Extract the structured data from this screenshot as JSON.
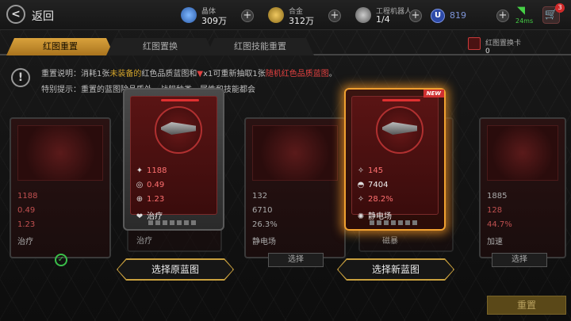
{
  "header": {
    "back_label": "返回",
    "resources": [
      {
        "name": "crystal",
        "label": "晶体",
        "value": "309万",
        "color": "#4a8fe0"
      },
      {
        "name": "alloy",
        "label": "合金",
        "value": "312万",
        "color": "#d4a52c"
      },
      {
        "name": "robot",
        "label": "工程机器人",
        "value": "1/4",
        "color": "#9a9a9a"
      }
    ],
    "u_value": "819",
    "ping": "24ms",
    "cart_badge": "3"
  },
  "tabs": [
    {
      "label": "红图重置",
      "active": true
    },
    {
      "label": "红图置换",
      "active": false
    },
    {
      "label": "红图技能重置",
      "active": false
    }
  ],
  "card_counter": {
    "label": "红图置换卡",
    "value": "0"
  },
  "notes": {
    "line1_a": "重置说明：消耗1张",
    "line1_b": "未装备的",
    "line1_c": "红色品质蓝图和",
    "line1_d": "x1可重新抽取1张",
    "line1_e": "随机红色品质蓝图",
    "line1_f": "。",
    "line2": "特别提示：重置的蓝图除品质外，战舰种类、属性和技能都会"
  },
  "cards": [
    {
      "stats": [
        "1188",
        "0.49",
        "1.23",
        "治疗"
      ]
    },
    {
      "stats": [
        "132",
        "6710",
        "26.3%",
        "静电场"
      ]
    },
    {
      "stats": [
        "1885",
        "128",
        "44.7%",
        "加速"
      ]
    }
  ],
  "popup_old": {
    "stats": [
      "1188",
      "0.49",
      "1.23",
      "治疗"
    ],
    "icons": [
      "✦",
      "◎",
      "⊕",
      "❤"
    ]
  },
  "popup_new": {
    "badge": "NEW",
    "stats": [
      "145",
      "7404",
      "28.2%",
      "静电场"
    ],
    "icons": [
      "✧",
      "◓",
      "✧",
      "✺"
    ]
  },
  "buttons": {
    "select_old": "选择原蓝图",
    "select_new": "选择新蓝图",
    "select_small": "选择",
    "reset": "重置",
    "behind_old": "治疗",
    "behind_new": "磁暴"
  },
  "colors": {
    "accent": "#d9a23c",
    "danger": "#e03030",
    "stat_red": "#ff6060"
  }
}
